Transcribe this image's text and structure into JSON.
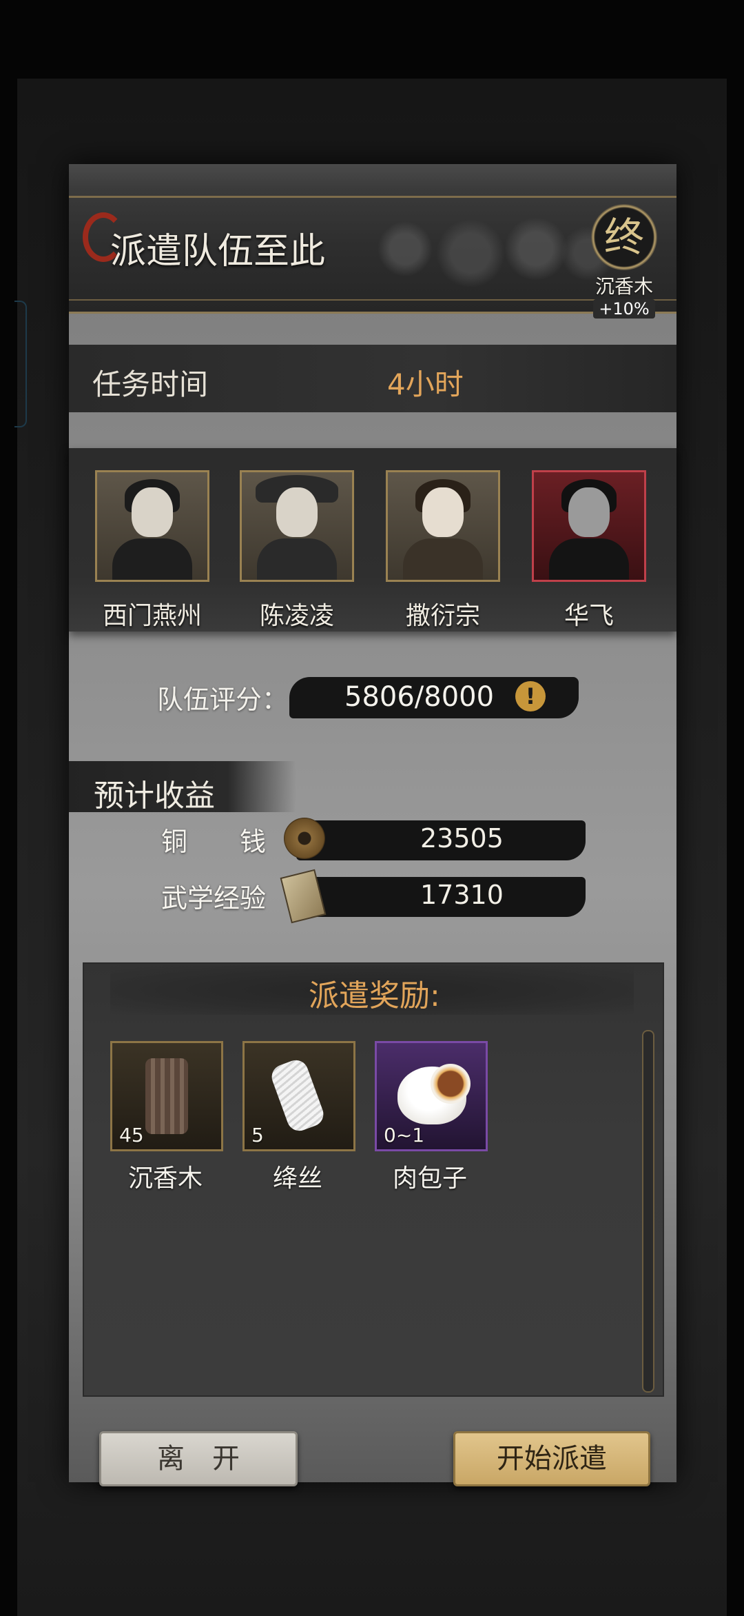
{
  "header": {
    "title": "派遣队伍至此",
    "bonus": {
      "glyph": "终",
      "name": "沉香木",
      "percent": "+10%"
    }
  },
  "task": {
    "label": "任务时间",
    "value": "4小时"
  },
  "team": [
    {
      "name": "西门燕州",
      "frame": "gold"
    },
    {
      "name": "陈凌凌",
      "frame": "gold"
    },
    {
      "name": "撒衍宗",
      "frame": "gold"
    },
    {
      "name": "华飞",
      "frame": "red"
    }
  ],
  "score": {
    "label": "队伍评分：",
    "value": "5806/8000",
    "warn_symbol": "!"
  },
  "income": {
    "title": "预计收益",
    "copper": {
      "label": "铜　　钱",
      "value": "23505",
      "icon": "coin-icon"
    },
    "exp": {
      "label": "武学经验",
      "value": "17310",
      "icon": "book-icon"
    }
  },
  "rewards": {
    "title": "派遣奖励:",
    "items": [
      {
        "name": "沉香木",
        "qty": "45",
        "rarity": "gold"
      },
      {
        "name": "绛丝",
        "qty": "5",
        "rarity": "gold"
      },
      {
        "name": "肉包子",
        "qty": "0~1",
        "rarity": "purple"
      }
    ]
  },
  "buttons": {
    "leave": "离　开",
    "start": "开始派遣"
  },
  "colors": {
    "accent_gold": "#e2a55a",
    "frame_gold": "#9a8252",
    "frame_red": "#c0404a",
    "frame_purple": "#7a4aa6"
  }
}
